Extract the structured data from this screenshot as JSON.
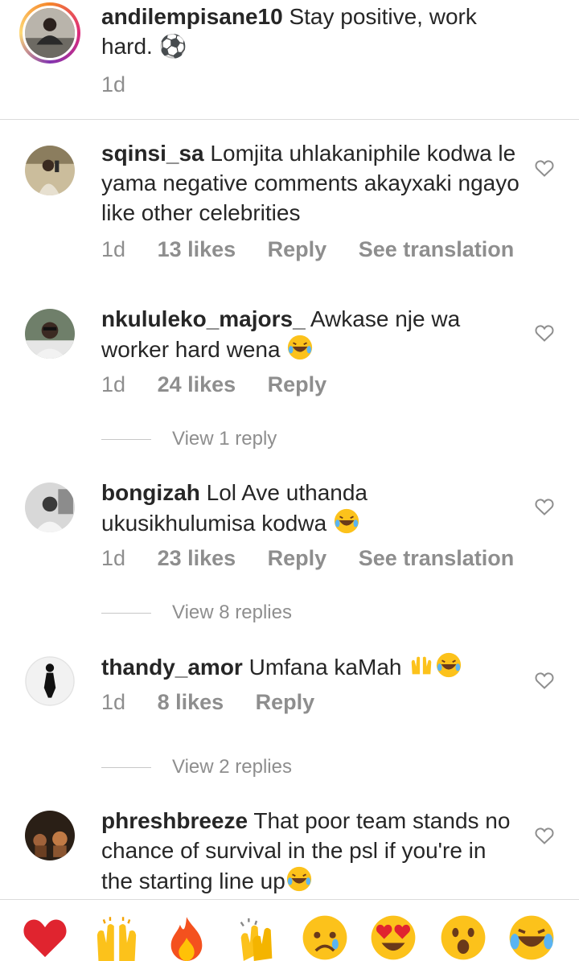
{
  "comments": [
    {
      "username": "andilempisane10",
      "text": "Stay positive, work hard. ⚽",
      "time": "1d",
      "likes": "",
      "reply": "",
      "translate": "",
      "has_heart": false
    },
    {
      "username": "sqinsi_sa",
      "text": "Lomjita uhlakaniphile kodwa le yama negative comments akayxaki ngayo like other celebrities",
      "time": "1d",
      "likes": "13 likes",
      "reply": "Reply",
      "translate": "See translation",
      "has_heart": true
    },
    {
      "username": "nkululeko_majors_",
      "text": "Awkase nje wa worker hard wena",
      "time": "1d",
      "likes": "24 likes",
      "reply": "Reply",
      "translate": "",
      "has_heart": true
    },
    {
      "username": "bongizah",
      "text": "Lol Ave uthanda ukusikhulumisa kodwa",
      "time": "1d",
      "likes": "23 likes",
      "reply": "Reply",
      "translate": "See translation",
      "has_heart": true
    },
    {
      "username": "thandy_amor",
      "text": "Umfana kaMah",
      "time": "1d",
      "likes": "8 likes",
      "reply": "Reply",
      "translate": "",
      "has_heart": true
    },
    {
      "username": "phreshbreeze",
      "text": "That poor team stands no chance of survival in the psl if you're in the starting line up",
      "time": "",
      "likes": "",
      "reply": "",
      "translate": "",
      "has_heart": true
    }
  ],
  "view_replies": [
    "View 1 reply",
    "View 8 replies",
    "View 2 replies"
  ],
  "reactions": [
    "red-heart",
    "raising-hands",
    "fire",
    "clapping-hands",
    "sad-face",
    "heart-eyes",
    "surprised-face",
    "tears-of-joy"
  ]
}
